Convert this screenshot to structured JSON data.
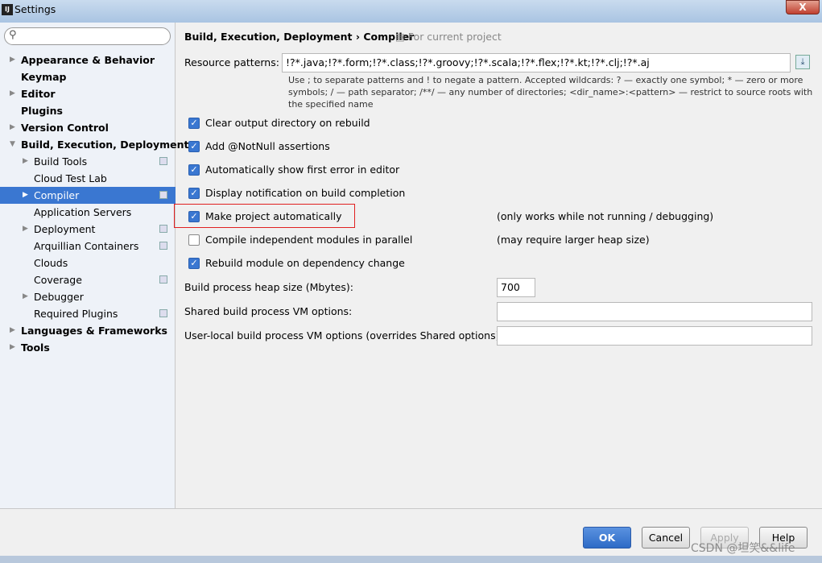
{
  "window": {
    "title": "Settings",
    "close_label": "X"
  },
  "search": {
    "placeholder": ""
  },
  "tree": [
    {
      "label": "Appearance & Behavior",
      "level": 0,
      "arrow": true,
      "bold": true
    },
    {
      "label": "Keymap",
      "level": 0,
      "arrow": false,
      "bold": true
    },
    {
      "label": "Editor",
      "level": 0,
      "arrow": true,
      "bold": true
    },
    {
      "label": "Plugins",
      "level": 0,
      "arrow": false,
      "bold": true
    },
    {
      "label": "Version Control",
      "level": 0,
      "arrow": true,
      "bold": true
    },
    {
      "label": "Build, Execution, Deployment",
      "level": 0,
      "arrow": "open",
      "bold": true
    },
    {
      "label": "Build Tools",
      "level": 1,
      "arrow": true,
      "copy": true
    },
    {
      "label": "Cloud Test Lab",
      "level": 1,
      "arrow": false
    },
    {
      "label": "Compiler",
      "level": 1,
      "arrow": true,
      "copy": true,
      "selected": true
    },
    {
      "label": "Application Servers",
      "level": 1,
      "arrow": false
    },
    {
      "label": "Deployment",
      "level": 1,
      "arrow": true,
      "copy": true
    },
    {
      "label": "Arquillian Containers",
      "level": 1,
      "arrow": false,
      "copy": true
    },
    {
      "label": "Clouds",
      "level": 1,
      "arrow": false
    },
    {
      "label": "Coverage",
      "level": 1,
      "arrow": false,
      "copy": true
    },
    {
      "label": "Debugger",
      "level": 1,
      "arrow": true
    },
    {
      "label": "Required Plugins",
      "level": 1,
      "arrow": false,
      "copy": true
    },
    {
      "label": "Languages & Frameworks",
      "level": 0,
      "arrow": true,
      "bold": true
    },
    {
      "label": "Tools",
      "level": 0,
      "arrow": true,
      "bold": true
    }
  ],
  "breadcrumb": {
    "path": "Build, Execution, Deployment › Compiler",
    "scope": "For current project"
  },
  "resource": {
    "label": "Resource patterns:",
    "value": "!?*.java;!?*.form;!?*.class;!?*.groovy;!?*.scala;!?*.flex;!?*.kt;!?*.clj;!?*.aj",
    "hint": "Use ; to separate patterns and ! to negate a pattern. Accepted wildcards: ? — exactly one symbol; * — zero or more symbols; / — path separator; /**/ — any number of directories;  <dir_name>:<pattern> — restrict to source roots with the specified name"
  },
  "options": [
    {
      "label": "Clear output directory on rebuild",
      "checked": true,
      "note": ""
    },
    {
      "label": "Add @NotNull assertions",
      "checked": true,
      "note": ""
    },
    {
      "label": "Automatically show first error in editor",
      "checked": true,
      "note": ""
    },
    {
      "label": "Display notification on build completion",
      "checked": true,
      "note": ""
    },
    {
      "label": "Make project automatically",
      "checked": true,
      "note": "(only works while not running / debugging)"
    },
    {
      "label": "Compile independent modules in parallel",
      "checked": false,
      "note": "(may require larger heap size)"
    },
    {
      "label": "Rebuild module on dependency change",
      "checked": true,
      "note": ""
    }
  ],
  "heap": {
    "label": "Build process heap size (Mbytes):",
    "value": "700"
  },
  "shared_vm": {
    "label": "Shared build process VM options:",
    "value": ""
  },
  "local_vm": {
    "label": "User-local build process VM options (overrides Shared options):",
    "value": ""
  },
  "buttons": {
    "ok": "OK",
    "cancel": "Cancel",
    "apply": "Apply",
    "help": "Help"
  },
  "watermark": "CSDN @坦笑&&life"
}
